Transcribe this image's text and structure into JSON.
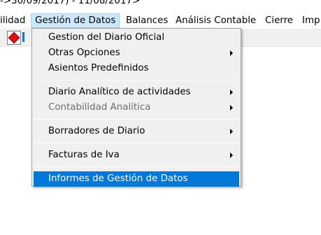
{
  "window": {
    "title_fragment": "->30/09/2017) - 11/08/2017>"
  },
  "menubar": {
    "items": [
      {
        "label": "ilidad"
      },
      {
        "label": "Gestión de Datos"
      },
      {
        "label": "Balances"
      },
      {
        "label": "Análisis Contable"
      },
      {
        "label": "Cierre"
      },
      {
        "label": "Imp"
      }
    ],
    "active_index": 1
  },
  "toolbar": {
    "icons": [
      "stop-icon",
      "toolbar-button-icon"
    ]
  },
  "dropdown": {
    "items": [
      {
        "label": "Gestion del Diario Oficial",
        "submenu": false,
        "enabled": true
      },
      {
        "label": "Otras Opciones",
        "submenu": true,
        "enabled": true
      },
      {
        "label": "Asientos Predefinidos",
        "submenu": false,
        "enabled": true
      },
      {
        "label": "Diario Analítico de actividades",
        "submenu": true,
        "enabled": true
      },
      {
        "label": "Contabilidad Analítica",
        "submenu": true,
        "enabled": false
      },
      {
        "label": "Borradores de Diario",
        "submenu": true,
        "enabled": true
      },
      {
        "label": "Facturas de Iva",
        "submenu": true,
        "enabled": true
      },
      {
        "label": "Informes de Gestión de Datos",
        "submenu": false,
        "enabled": true,
        "highlighted": true
      }
    ]
  },
  "colors": {
    "menu_highlight": "#0078d7",
    "menubar_active": "#cce8ff",
    "menu_background": "#f0f0f0",
    "disabled_text": "#6d6d6d"
  }
}
